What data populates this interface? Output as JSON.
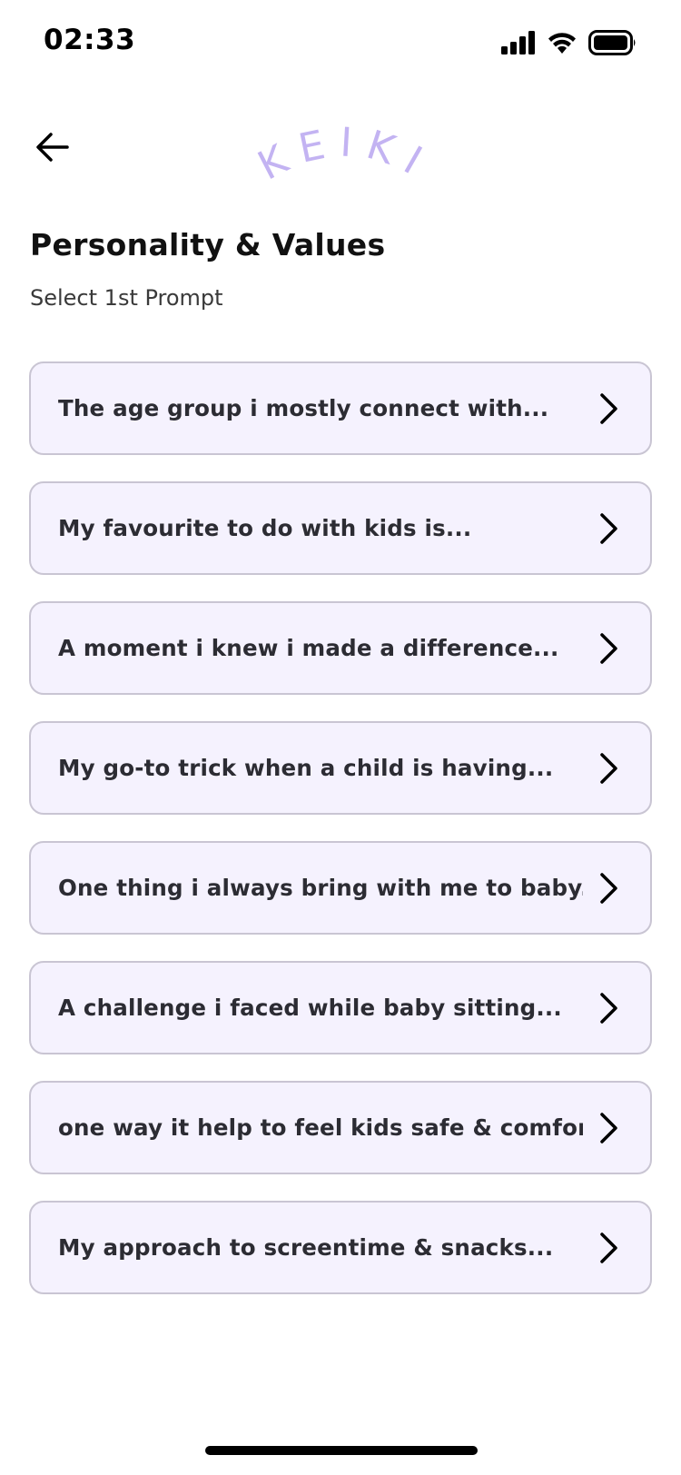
{
  "status_bar": {
    "time": "02:33",
    "icons": [
      "cellular-signal-icon",
      "wifi-icon",
      "battery-icon"
    ]
  },
  "header": {
    "back_icon": "arrow-left-icon",
    "logo_text": "KEIKI",
    "logo_color": "#c3b3f2"
  },
  "page": {
    "title": "Personality & Values",
    "subtitle": "Select 1st Prompt"
  },
  "prompts": [
    {
      "label": "The age group i mostly connect with..."
    },
    {
      "label": "My favourite to do with kids is..."
    },
    {
      "label": "A moment i knew i made a difference..."
    },
    {
      "label": "My go-to trick when a child is having..."
    },
    {
      "label": "One thing i always bring with me to baby..."
    },
    {
      "label": "A challenge i faced while baby sitting..."
    },
    {
      "label": "one way it help to feel kids safe & comfort..."
    },
    {
      "label": "My approach to screentime & snacks..."
    }
  ],
  "colors": {
    "card_background": "#f5f2fe",
    "card_border": "#c9c5d3",
    "text_primary": "#111111"
  }
}
